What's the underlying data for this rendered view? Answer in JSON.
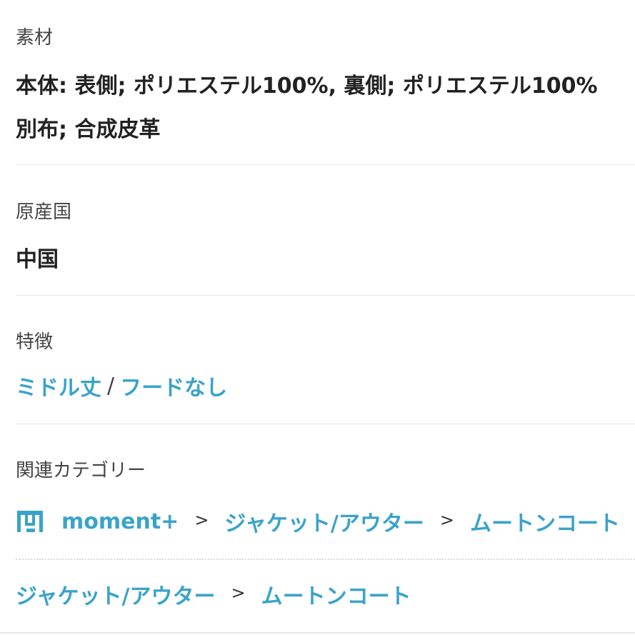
{
  "material": {
    "label": "素材",
    "value_line1": "本体: 表側; ポリエステル100%, 裏側; ポリエステル100%",
    "value_line2": "別布; 合成皮革"
  },
  "origin": {
    "label": "原産国",
    "value": "中国"
  },
  "features": {
    "label": "特徴",
    "items": [
      "ミドル丈",
      "フードなし"
    ],
    "separator": "/"
  },
  "categories": {
    "label": "関連カテゴリー",
    "path1": [
      "moment+",
      "ジャケット/アウター",
      "ムートンコート"
    ],
    "path2": [
      "ジャケット/アウター",
      "ムートンコート"
    ],
    "chevron": ">",
    "shop_icon": "store-icon"
  },
  "colors": {
    "link": "#3aa3c9",
    "text": "#222222",
    "label": "#444444",
    "divider": "#e6e6e6"
  }
}
